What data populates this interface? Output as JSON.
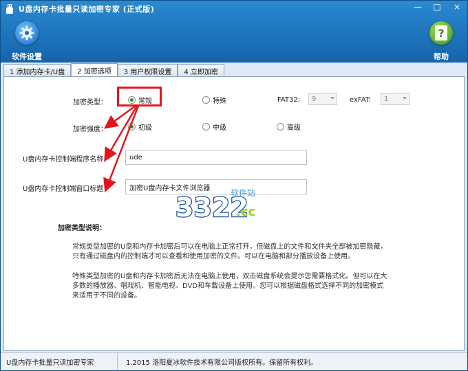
{
  "window": {
    "title": "U盘内存卡批量只读加密专家 (正式版)",
    "controls": {
      "minimize": "—",
      "maximize": "□",
      "close": "×"
    }
  },
  "toolbar": {
    "settings_label": "软件设置",
    "settings_icon": "gear-icon",
    "help_label": "帮助",
    "help_icon": "help-icon"
  },
  "tabs": [
    {
      "label": "1 添加内存卡/U盘",
      "active": false
    },
    {
      "label": "2 加密选项",
      "active": true
    },
    {
      "label": "3 用户权限设置",
      "active": false
    },
    {
      "label": "4 立即加密",
      "active": false
    }
  ],
  "form": {
    "encrypt_type_label": "加密类型：",
    "encrypt_type_options": [
      "常规",
      "特殊"
    ],
    "encrypt_type_selected": "常规",
    "fat32_label": "FAT32:",
    "fat32_value": "9",
    "exfat_label": "exFAT:",
    "exfat_value": "1",
    "strength_label": "加密强度：",
    "strength_options": [
      "初级",
      "中级",
      "高级"
    ],
    "strength_selected": "初级",
    "program_name_label": "U盘内存卡控制端程序名称：",
    "program_name_value": "ude",
    "window_title_label": "U盘内存卡控制端窗口标题：",
    "window_title_value": "加密U盘内存卡文件浏览器"
  },
  "description": {
    "title": "加密类型说明：",
    "para1": "常规类型加密的U盘和内存卡加密后可以在电脑上正常打开，但磁盘上的文件和文件夹全部被加密隐藏，只有通过磁盘内的控制端才可以查看和使用加密的文件。可以在电脑和部分播放设备上使用。",
    "para2": "特殊类型加密的U盘和内存卡加密后无法在电脑上使用，双击磁盘系统会提示您需要格式化。但可以在大多数的播放器、唱戏机、智能电视、DVD和车载设备上使用。您可以根据磁盘格式选择不同的加密模式来适用于不同的设备。"
  },
  "watermark": {
    "main": "3322",
    "suffix": ".cc",
    "sub": "软件站"
  },
  "status": {
    "left": "U盘内存卡批量只读加密专家",
    "right": "1.2015 洛阳夏冰软件技术有限公司版权所有。保留所有权利。"
  },
  "colors": {
    "accent": "#1563ab",
    "annotation": "#e0161d",
    "radio_on": "#2e8b2e"
  }
}
